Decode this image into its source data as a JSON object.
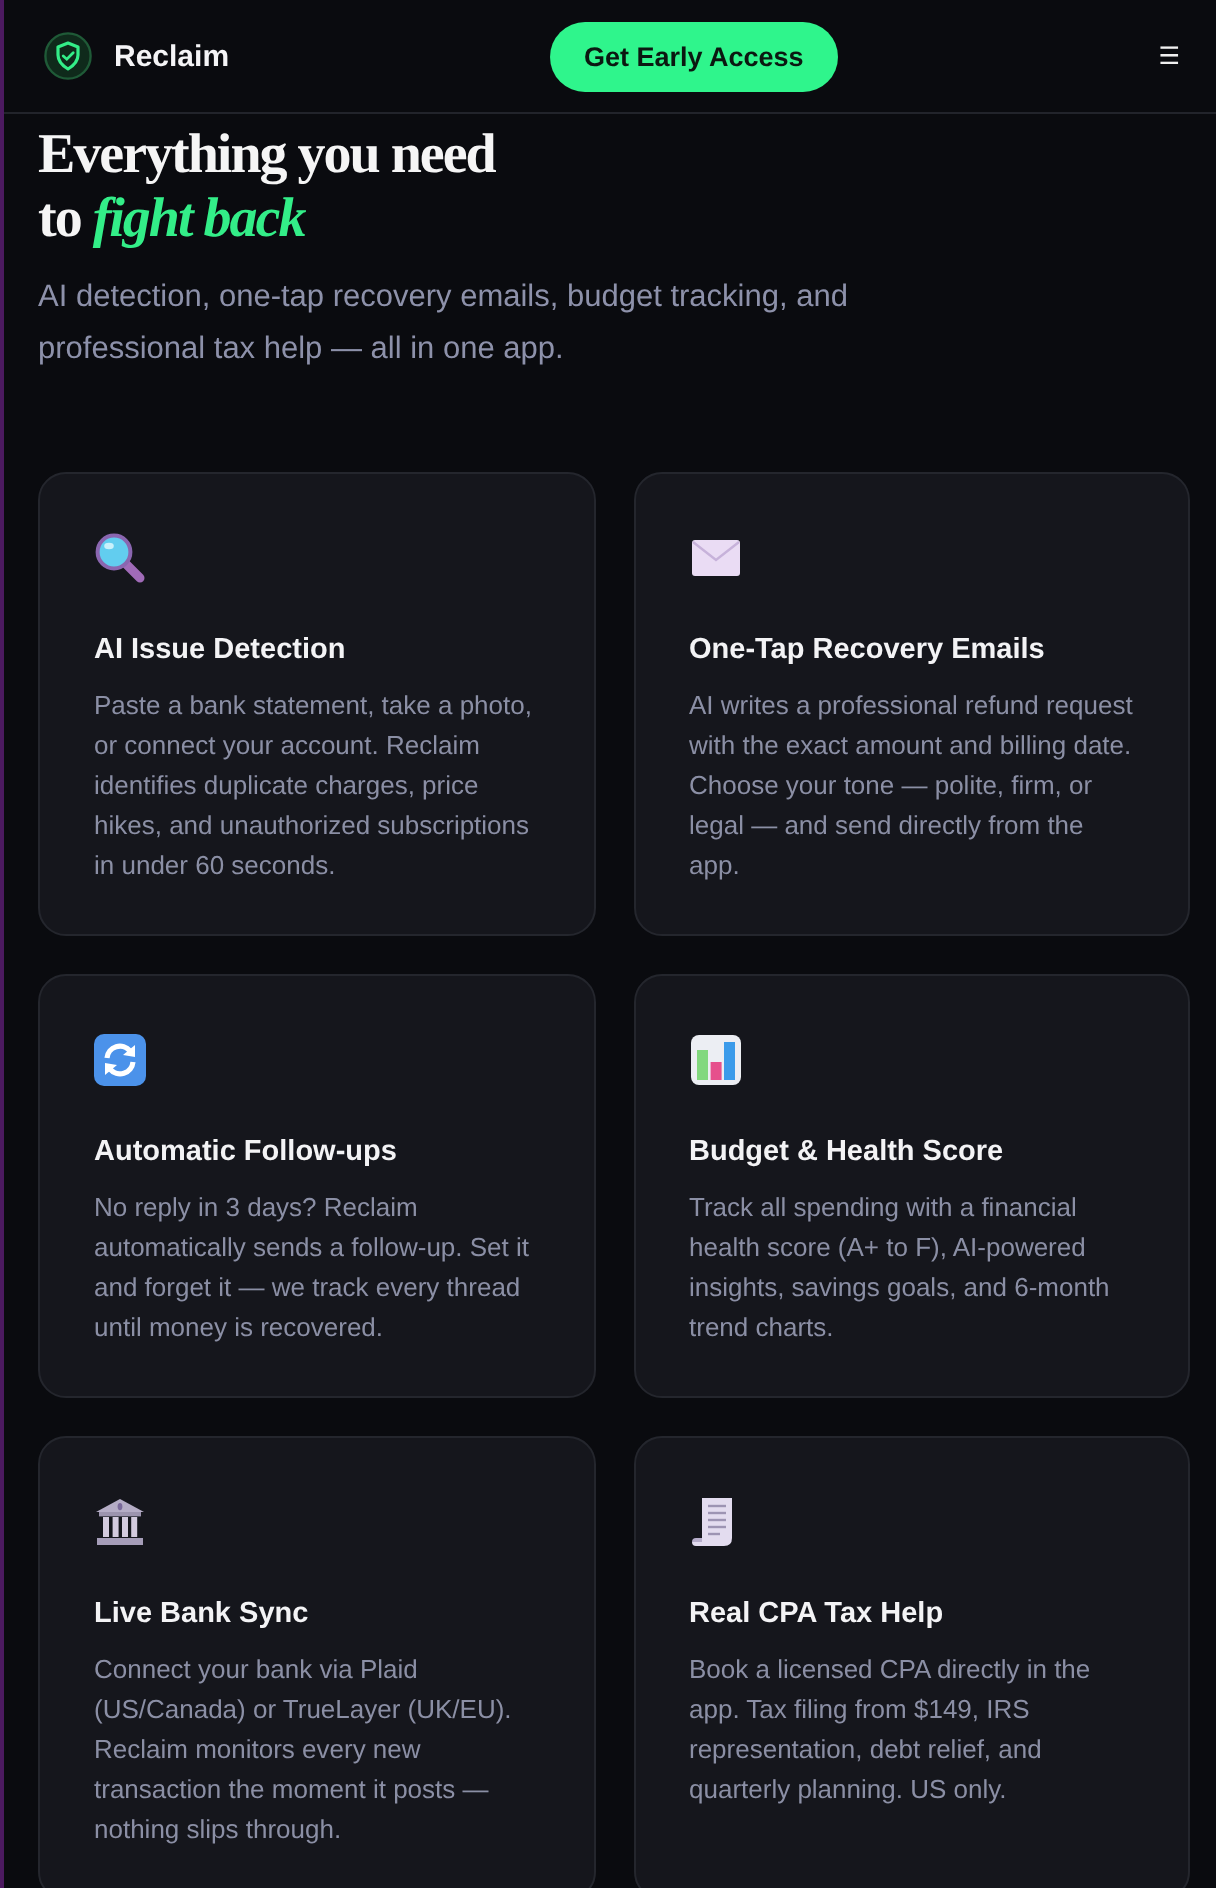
{
  "header": {
    "brand": "Reclaim",
    "cta": "Get Early Access",
    "menu_glyph": "☰"
  },
  "hero": {
    "title_lines": [
      "Everything you need",
      "to *fight back*"
    ],
    "subtitle": "AI detection, one-tap recovery emails, budget tracking, and professional tax help — all in one app."
  },
  "features": [
    {
      "kind": "magnifier",
      "title": "AI Issue Detection",
      "description": "Paste a bank statement, take a photo, or connect your account. Reclaim identifies duplicate charges, price hikes, and unauthorized subscriptions in under 60 seconds."
    },
    {
      "kind": "envelope",
      "title": "One-Tap Recovery Emails",
      "description": "AI writes a professional refund request with the exact amount and billing date. Choose your tone — polite, firm, or legal — and send directly from the app."
    },
    {
      "kind": "refresh",
      "title": "Automatic Follow-ups",
      "description": "No reply in 3 days? Reclaim automatically sends a follow-up. Set it and forget it — we track every thread until money is recovered."
    },
    {
      "kind": "chart",
      "title": "Budget & Health Score",
      "description": "Track all spending with a financial health score (A+ to F), AI-powered insights, savings goals, and 6-month trend charts."
    },
    {
      "kind": "bank",
      "title": "Live Bank Sync",
      "description": "Connect your bank via Plaid (US/Canada) or TrueLayer (UK/EU). Reclaim monitors every new transaction the moment it posts — nothing slips through."
    },
    {
      "kind": "receipt",
      "title": "Real CPA Tax Help",
      "description": "Book a licensed CPA directly in the app. Tax filing from $149, IRS representation, debt relief, and quarterly planning. US only."
    }
  ]
}
